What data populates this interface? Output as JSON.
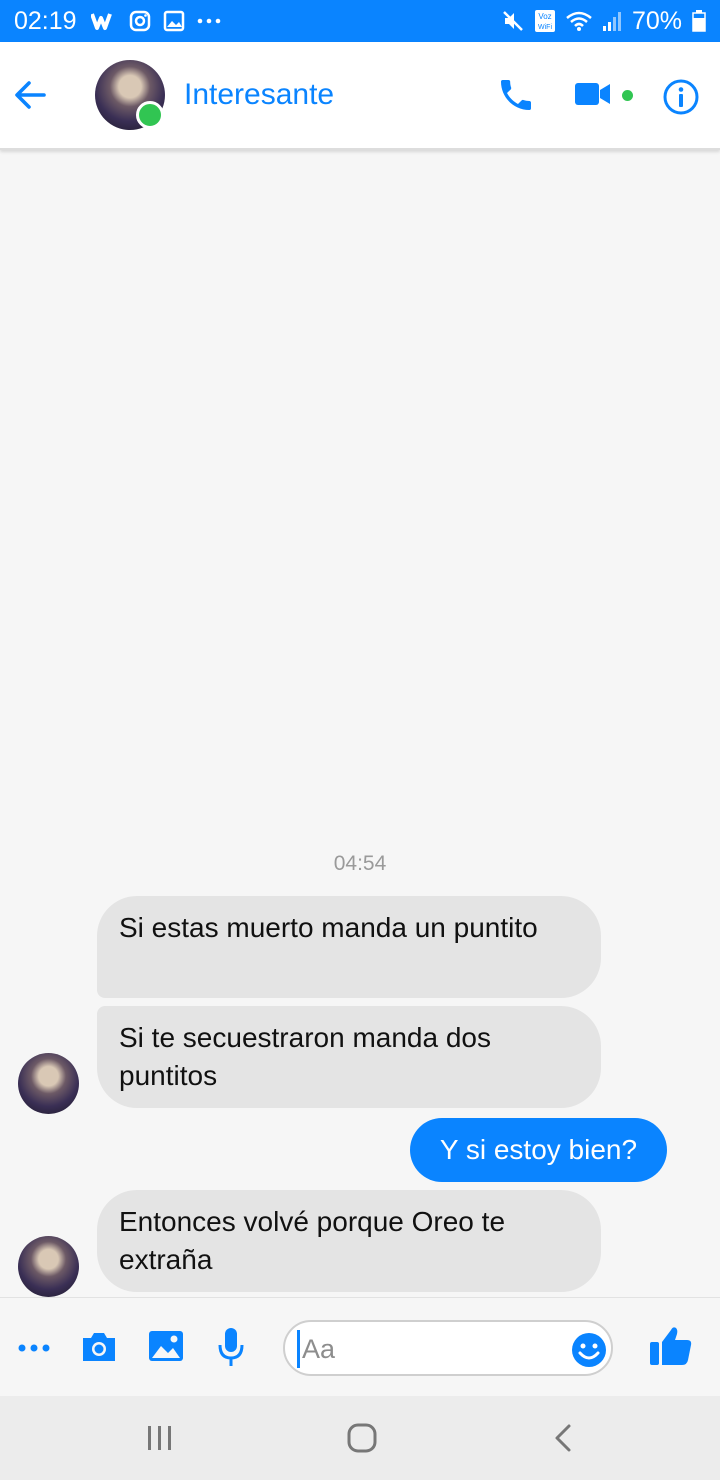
{
  "status_bar": {
    "time": "02:19",
    "battery": "70%",
    "left_icons": [
      "wattpad-icon",
      "instagram-icon",
      "gallery-icon",
      "more-dots-icon"
    ],
    "right_icons": [
      "mute-icon",
      "voz-wifi-icon",
      "wifi-icon",
      "signal-icon",
      "battery-icon"
    ]
  },
  "header": {
    "contact_name": "Interesante",
    "online": true
  },
  "conversation": {
    "timestamp": "04:54",
    "messages": [
      {
        "sender": "contact",
        "text": "Si estas muerto manda un puntito"
      },
      {
        "sender": "contact",
        "text": "Si te secuestraron manda dos puntitos"
      },
      {
        "sender": "me",
        "text": "Y si estoy bien?"
      },
      {
        "sender": "contact",
        "text": "Entonces volvé porque Oreo te extraña"
      }
    ]
  },
  "composer": {
    "placeholder": "Aa",
    "value": ""
  },
  "colors": {
    "accent": "#0a84ff",
    "online": "#31c552",
    "incoming_bubble": "#e4e4e4",
    "outgoing_bubble": "#0a84ff"
  }
}
